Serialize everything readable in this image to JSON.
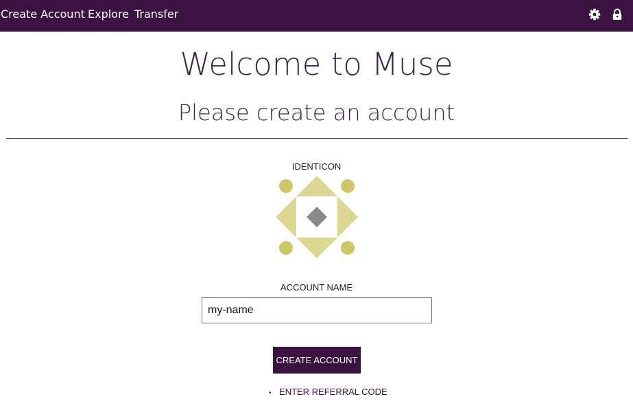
{
  "nav": {
    "create_account": "Create Account",
    "explore": "Explore",
    "transfer": "Transfer",
    "settings_icon": "gear-icon",
    "lock_icon": "lock-icon"
  },
  "colors": {
    "nav_bg": "#3b1241",
    "heading": "#38274a",
    "identicon_primary": "#cfc66a",
    "identicon_secondary": "#dcd792",
    "identicon_center": "#888888"
  },
  "main": {
    "title": "Welcome to Muse",
    "subtitle": "Please create an account",
    "identicon_label": "IDENTICON",
    "account_name_label": "ACCOUNT NAME",
    "account_name_value": "my-name",
    "create_button": "CREATE ACCOUNT",
    "referral_link": "ENTER REFERRAL CODE"
  }
}
